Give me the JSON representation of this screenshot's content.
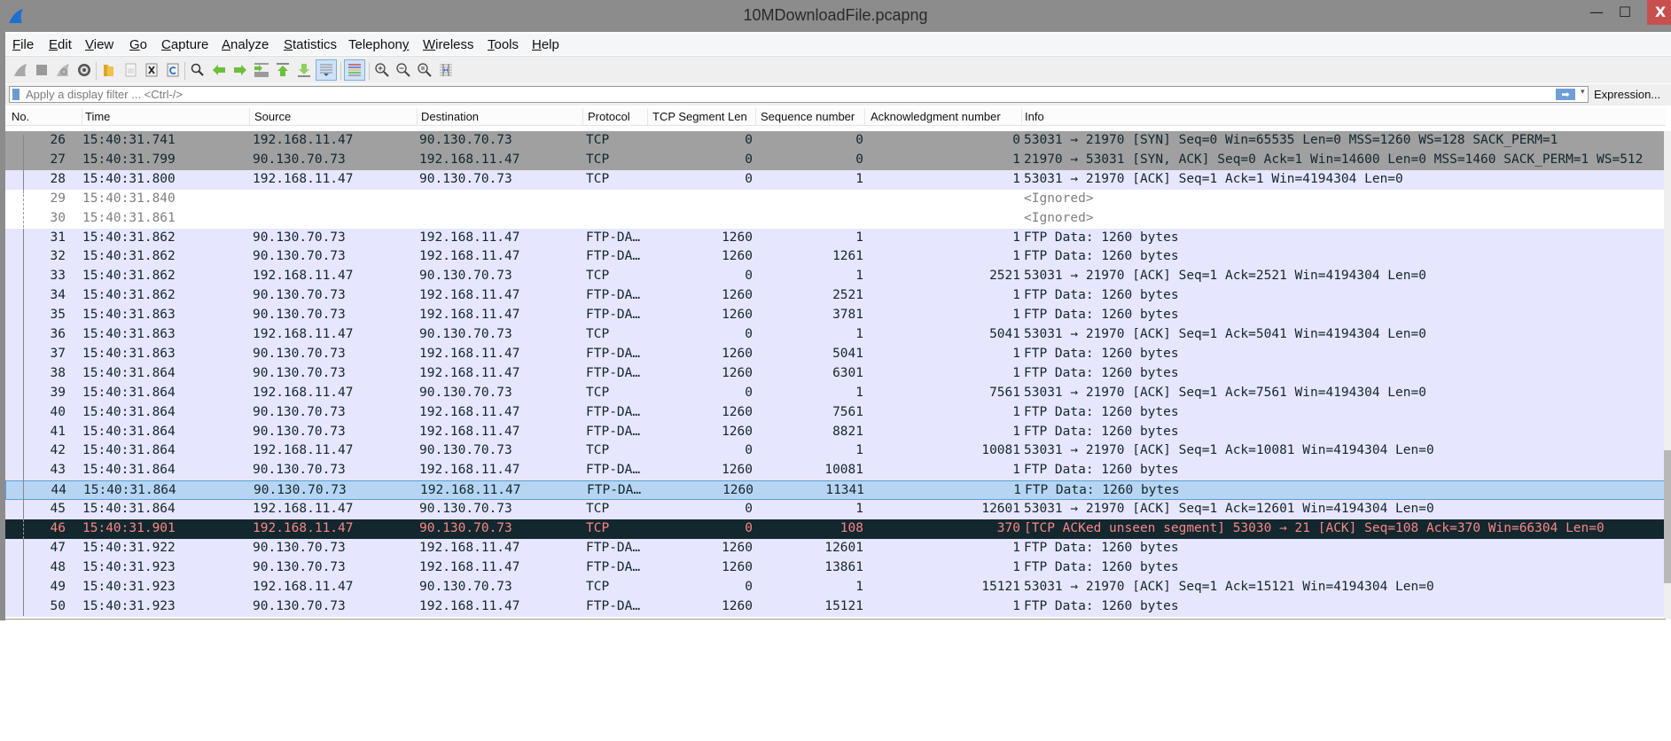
{
  "window": {
    "title": "10MDownloadFile.pcapng",
    "minimize_glyph": "—",
    "maximize_glyph": "☐",
    "close_glyph": "X"
  },
  "menu": {
    "items": [
      {
        "label": "File",
        "mnemonic": "F",
        "rest": "ile"
      },
      {
        "label": "Edit",
        "mnemonic": "E",
        "rest": "dit"
      },
      {
        "label": "View",
        "mnemonic": "V",
        "rest": "iew"
      },
      {
        "label": "Go",
        "mnemonic": "G",
        "rest": "o"
      },
      {
        "label": "Capture",
        "mnemonic": "C",
        "rest": "apture"
      },
      {
        "label": "Analyze",
        "mnemonic": "A",
        "rest": "nalyze"
      },
      {
        "label": "Statistics",
        "mnemonic": "S",
        "rest": "tatistics"
      },
      {
        "label": "Telephony",
        "mnemonic": "y",
        "rest": "Telephon"
      },
      {
        "label": "Wireless",
        "mnemonic": "W",
        "rest": "ireless"
      },
      {
        "label": "Tools",
        "mnemonic": "T",
        "rest": "ools"
      },
      {
        "label": "Help",
        "mnemonic": "H",
        "rest": "elp"
      }
    ]
  },
  "toolbar": {
    "buttons": [
      "start-capture-icon",
      "stop-capture-icon",
      "restart-capture-icon",
      "capture-options-icon",
      "open-file-icon",
      "save-file-icon",
      "close-file-icon",
      "reload-file-icon",
      "find-packet-icon",
      "go-back-icon",
      "go-forward-icon",
      "go-to-packet-icon",
      "go-first-packet-icon",
      "go-last-packet-icon",
      "autoscroll-icon",
      "colorize-icon",
      "zoom-in-icon",
      "zoom-out-icon",
      "zoom-normal-icon",
      "resize-columns-icon"
    ]
  },
  "filter": {
    "placeholder": "Apply a display filter ... <Ctrl-/>",
    "value": "",
    "apply_glyph": "➡",
    "dropdown_glyph": "▾",
    "expression_label": "Expression..."
  },
  "columns": [
    "No.",
    "Time",
    "Source",
    "Destination",
    "Protocol",
    "TCP Segment Len",
    "Sequence number",
    "Acknowledgment number",
    "Info"
  ],
  "packets": [
    {
      "no": "26",
      "time": "15:40:31.741",
      "src": "192.168.11.47",
      "dst": "90.130.70.73",
      "proto": "TCP",
      "seglen": "0",
      "seq": "0",
      "ack": "0",
      "info": "53031 → 21970 [SYN] Seq=0 Win=65535 Len=0 MSS=1260 WS=128 SACK_PERM=1",
      "style": "syn"
    },
    {
      "no": "27",
      "time": "15:40:31.799",
      "src": "90.130.70.73",
      "dst": "192.168.11.47",
      "proto": "TCP",
      "seglen": "0",
      "seq": "0",
      "ack": "1",
      "info": "21970 → 53031 [SYN, ACK] Seq=0 Ack=1 Win=14600 Len=0 MSS=1460 SACK_PERM=1 WS=512",
      "style": "syn"
    },
    {
      "no": "28",
      "time": "15:40:31.800",
      "src": "192.168.11.47",
      "dst": "90.130.70.73",
      "proto": "TCP",
      "seglen": "0",
      "seq": "1",
      "ack": "1",
      "info": "53031 → 21970 [ACK] Seq=1 Ack=1 Win=4194304 Len=0",
      "style": "tcp"
    },
    {
      "no": "29",
      "time": "15:40:31.840",
      "src": "",
      "dst": "",
      "proto": "",
      "seglen": "",
      "seq": "",
      "ack": "",
      "info": "<Ignored>",
      "style": "ignored"
    },
    {
      "no": "30",
      "time": "15:40:31.861",
      "src": "",
      "dst": "",
      "proto": "",
      "seglen": "",
      "seq": "",
      "ack": "",
      "info": "<Ignored>",
      "style": "ignored"
    },
    {
      "no": "31",
      "time": "15:40:31.862",
      "src": "90.130.70.73",
      "dst": "192.168.11.47",
      "proto": "FTP-DA…",
      "seglen": "1260",
      "seq": "1",
      "ack": "1",
      "info": "FTP Data: 1260 bytes",
      "style": "tcp"
    },
    {
      "no": "32",
      "time": "15:40:31.862",
      "src": "90.130.70.73",
      "dst": "192.168.11.47",
      "proto": "FTP-DA…",
      "seglen": "1260",
      "seq": "1261",
      "ack": "1",
      "info": "FTP Data: 1260 bytes",
      "style": "tcp"
    },
    {
      "no": "33",
      "time": "15:40:31.862",
      "src": "192.168.11.47",
      "dst": "90.130.70.73",
      "proto": "TCP",
      "seglen": "0",
      "seq": "1",
      "ack": "2521",
      "info": "53031 → 21970 [ACK] Seq=1 Ack=2521 Win=4194304 Len=0",
      "style": "tcp"
    },
    {
      "no": "34",
      "time": "15:40:31.862",
      "src": "90.130.70.73",
      "dst": "192.168.11.47",
      "proto": "FTP-DA…",
      "seglen": "1260",
      "seq": "2521",
      "ack": "1",
      "info": "FTP Data: 1260 bytes",
      "style": "tcp"
    },
    {
      "no": "35",
      "time": "15:40:31.863",
      "src": "90.130.70.73",
      "dst": "192.168.11.47",
      "proto": "FTP-DA…",
      "seglen": "1260",
      "seq": "3781",
      "ack": "1",
      "info": "FTP Data: 1260 bytes",
      "style": "tcp"
    },
    {
      "no": "36",
      "time": "15:40:31.863",
      "src": "192.168.11.47",
      "dst": "90.130.70.73",
      "proto": "TCP",
      "seglen": "0",
      "seq": "1",
      "ack": "5041",
      "info": "53031 → 21970 [ACK] Seq=1 Ack=5041 Win=4194304 Len=0",
      "style": "tcp"
    },
    {
      "no": "37",
      "time": "15:40:31.863",
      "src": "90.130.70.73",
      "dst": "192.168.11.47",
      "proto": "FTP-DA…",
      "seglen": "1260",
      "seq": "5041",
      "ack": "1",
      "info": "FTP Data: 1260 bytes",
      "style": "tcp"
    },
    {
      "no": "38",
      "time": "15:40:31.864",
      "src": "90.130.70.73",
      "dst": "192.168.11.47",
      "proto": "FTP-DA…",
      "seglen": "1260",
      "seq": "6301",
      "ack": "1",
      "info": "FTP Data: 1260 bytes",
      "style": "tcp"
    },
    {
      "no": "39",
      "time": "15:40:31.864",
      "src": "192.168.11.47",
      "dst": "90.130.70.73",
      "proto": "TCP",
      "seglen": "0",
      "seq": "1",
      "ack": "7561",
      "info": "53031 → 21970 [ACK] Seq=1 Ack=7561 Win=4194304 Len=0",
      "style": "tcp"
    },
    {
      "no": "40",
      "time": "15:40:31.864",
      "src": "90.130.70.73",
      "dst": "192.168.11.47",
      "proto": "FTP-DA…",
      "seglen": "1260",
      "seq": "7561",
      "ack": "1",
      "info": "FTP Data: 1260 bytes",
      "style": "tcp"
    },
    {
      "no": "41",
      "time": "15:40:31.864",
      "src": "90.130.70.73",
      "dst": "192.168.11.47",
      "proto": "FTP-DA…",
      "seglen": "1260",
      "seq": "8821",
      "ack": "1",
      "info": "FTP Data: 1260 bytes",
      "style": "tcp"
    },
    {
      "no": "42",
      "time": "15:40:31.864",
      "src": "192.168.11.47",
      "dst": "90.130.70.73",
      "proto": "TCP",
      "seglen": "0",
      "seq": "1",
      "ack": "10081",
      "info": "53031 → 21970 [ACK] Seq=1 Ack=10081 Win=4194304 Len=0",
      "style": "tcp"
    },
    {
      "no": "43",
      "time": "15:40:31.864",
      "src": "90.130.70.73",
      "dst": "192.168.11.47",
      "proto": "FTP-DA…",
      "seglen": "1260",
      "seq": "10081",
      "ack": "1",
      "info": "FTP Data: 1260 bytes",
      "style": "tcp"
    },
    {
      "no": "44",
      "time": "15:40:31.864",
      "src": "90.130.70.73",
      "dst": "192.168.11.47",
      "proto": "FTP-DA…",
      "seglen": "1260",
      "seq": "11341",
      "ack": "1",
      "info": "FTP Data: 1260 bytes",
      "style": "selected"
    },
    {
      "no": "45",
      "time": "15:40:31.864",
      "src": "192.168.11.47",
      "dst": "90.130.70.73",
      "proto": "TCP",
      "seglen": "0",
      "seq": "1",
      "ack": "12601",
      "info": "53031 → 21970 [ACK] Seq=1 Ack=12601 Win=4194304 Len=0",
      "style": "tcp"
    },
    {
      "no": "46",
      "time": "15:40:31.901",
      "src": "192.168.11.47",
      "dst": "90.130.70.73",
      "proto": "TCP",
      "seglen": "0",
      "seq": "108",
      "ack": "370",
      "info": "[TCP ACKed unseen segment] 53030 → 21 [ACK] Seq=108 Ack=370 Win=66304 Len=0",
      "style": "bad"
    },
    {
      "no": "47",
      "time": "15:40:31.922",
      "src": "90.130.70.73",
      "dst": "192.168.11.47",
      "proto": "FTP-DA…",
      "seglen": "1260",
      "seq": "12601",
      "ack": "1",
      "info": "FTP Data: 1260 bytes",
      "style": "tcp"
    },
    {
      "no": "48",
      "time": "15:40:31.923",
      "src": "90.130.70.73",
      "dst": "192.168.11.47",
      "proto": "FTP-DA…",
      "seglen": "1260",
      "seq": "13861",
      "ack": "1",
      "info": "FTP Data: 1260 bytes",
      "style": "tcp"
    },
    {
      "no": "49",
      "time": "15:40:31.923",
      "src": "192.168.11.47",
      "dst": "90.130.70.73",
      "proto": "TCP",
      "seglen": "0",
      "seq": "1",
      "ack": "15121",
      "info": "53031 → 21970 [ACK] Seq=1 Ack=15121 Win=4194304 Len=0",
      "style": "tcp"
    },
    {
      "no": "50",
      "time": "15:40:31.923",
      "src": "90.130.70.73",
      "dst": "192.168.11.47",
      "proto": "FTP-DA…",
      "seglen": "1260",
      "seq": "15121",
      "ack": "1",
      "info": "FTP Data: 1260 bytes",
      "style": "tcp"
    }
  ],
  "colors": {
    "tcp_row": "#e7e6ff",
    "syn_row": "#a0a0a0",
    "selected_row": "#b7d5f3",
    "bad_row_bg": "#12272e",
    "bad_row_fg": "#f78787",
    "ignored_fg": "#7f7f7f",
    "close_button": "#c7504f"
  }
}
